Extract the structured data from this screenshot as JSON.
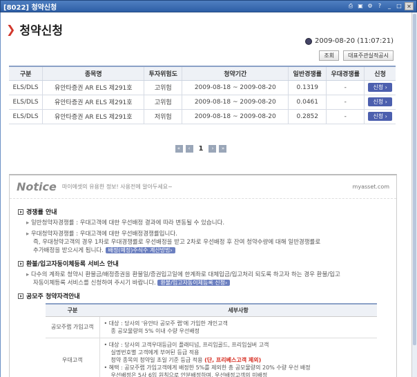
{
  "window": {
    "title": "[8022] 청약신청"
  },
  "page": {
    "title": "청약신청",
    "datetime": "2009-08-20 (11:07:21)"
  },
  "toolbar": {
    "query": "조회",
    "rep_account": "대표주관실적공시"
  },
  "table": {
    "headers": [
      "구분",
      "종목명",
      "투자위험도",
      "청약기간",
      "일반경쟁률",
      "우대경쟁률",
      "신청"
    ],
    "rows": [
      {
        "type": "ELS/DLS",
        "name": "유안타증권 AR ELS 제291호",
        "risk": "고위험",
        "period": "2009-08-18 ~ 2009-08-20",
        "general": "0.1319",
        "pref": "-",
        "apply": "신청 ›"
      },
      {
        "type": "ELS/DLS",
        "name": "유안타증권 AR ELS 제291호",
        "risk": "고위험",
        "period": "2009-08-18 ~ 2009-08-20",
        "general": "0.0461",
        "pref": "-",
        "apply": "신청 ›"
      },
      {
        "type": "ELS/DLS",
        "name": "유안타증권 AR ELS 제291호",
        "risk": "저위험",
        "period": "2009-08-18 ~ 2009-08-20",
        "general": "0.2852",
        "pref": "-",
        "apply": "신청 ›"
      }
    ]
  },
  "pager": {
    "current": "1"
  },
  "notice": {
    "title": "Notice",
    "subtitle": "마이에셋의 유용한 정보! 사용전에 알아두세요~",
    "logo": "myasset.com",
    "s1_title": "경쟁률 안내",
    "s1_l1": "일반청약자경쟁률 : 우대고객에 대한 우선배정 결과에 따라 변동될 수 있습니다.",
    "s1_l2": "우대청약자경쟁률 : 우대고객에 대한 우선배정경쟁률입니다.",
    "s1_l3": "즉, 우대청약고객의 경우 1차로 우대경쟁률로 우선배정을 받고 2차로 우선배정 후 잔여 청약수량에 대해 일반경쟁률로",
    "s1_l4": "추가배정을 받으시게 됩니다.",
    "s1_btn": "배정(예정)주식수 계산방법›",
    "s2_title": "환불/입고자동이체등록 서비스 안내",
    "s2_l1": "다수의 계좌로 청약시 환불금/배정증권을 환불일/증권입고일에 한계좌로 대체입금/입고처리 되도록 하고자 하는 경우 환불/입고",
    "s2_l2": "자동이체등록 서비스를 신청하여 주시기 바랍니다.",
    "s2_btn": "환불/입고자동이체등록 신청›",
    "s3_title": "공모주 청약자격안내",
    "sub_headers": [
      "구분",
      "세부사항"
    ],
    "row1_label": "공모주랩 가입고객",
    "row1_l1": "• 대상 : 당사의 '유안타 공모주 랩'에 가입한 개인고객",
    "row1_l2": "종 공모물량의 5% 이내 수량 우선배정",
    "row2_label": "우대고객",
    "row2_l1": "• 대상 : 당사의 고객우대등급이 플래티넘, 프리임골드, 프리임실버 고객",
    "row2_l2": "실명번호별 고객에게 부여된 등급 적용",
    "row2_l3": "청약 종목의 청약일 초일 기준 등급 적용",
    "row2_red": "(단, 프리베스고객 제외)",
    "row2_l4": "• 혜택 : 공모주랩 가입고객에게 배정한 5%를 제외한 총 공모물량의 20% 수량 우선 배정",
    "row2_l5": "우선배정은 5사 6입 원칙으로 안분배정하며, 우선배정고객의 미배정"
  }
}
